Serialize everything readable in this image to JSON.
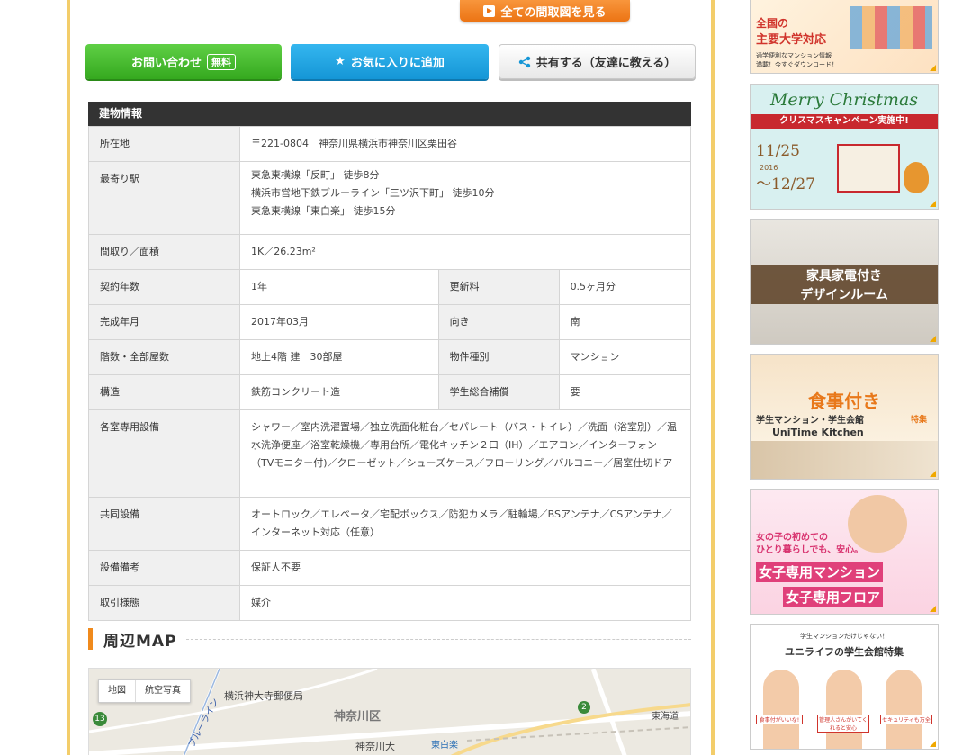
{
  "top_actions": {
    "floorplan_label": "全ての間取図を見る",
    "contact_label": "お問い合わせ",
    "contact_badge": "無料",
    "favorite_label": "お気に入りに追加",
    "share_label": "共有する（友達に教える）"
  },
  "building_info": {
    "title": "建物情報",
    "address_label": "所在地",
    "address_value": "〒221-0804　神奈川県横浜市神奈川区栗田谷",
    "station_label": "最寄り駅",
    "station_lines": [
      "東急東横線「反町」 徒歩8分",
      "横浜市営地下鉄ブルーライン「三ツ沢下町」 徒歩10分",
      "東急東横線「東白楽」 徒歩15分"
    ],
    "layout_label": "間取り／面積",
    "layout_value": "1K／26.23m²",
    "contract_label": "契約年数",
    "contract_value": "1年",
    "renewal_label": "更新料",
    "renewal_value": "0.5ヶ月分",
    "completed_label": "完成年月",
    "completed_value": "2017年03月",
    "direction_label": "向き",
    "direction_value": "南",
    "floors_label": "階数・全部屋数",
    "floors_value": "地上4階 建　30部屋",
    "type_label": "物件種別",
    "type_value": "マンション",
    "structure_label": "構造",
    "structure_value": "鉄筋コンクリート造",
    "insurance_label": "学生総合補償",
    "insurance_value": "要",
    "room_equip_label": "各室専用設備",
    "room_equip_value": "シャワー／室内洗濯置場／独立洗面化粧台／セパレート（バス・トイレ）／洗面（浴室別）／温水洗浄便座／浴室乾燥機／専用台所／電化キッチン２口（IH）／エアコン／インターフォン（TVモニター付)／クローゼット／シューズケース／フローリング／バルコニー／居室仕切ドア",
    "shared_equip_label": "共同設備",
    "shared_equip_value": "オートロック／エレベータ／宅配ボックス／防犯カメラ／駐輪場／BSアンテナ／CSアンテナ／インターネット対応（任意）",
    "equip_note_label": "設備備考",
    "equip_note_value": "保証人不要",
    "trade_label": "取引様態",
    "trade_value": "媒介"
  },
  "map_section": {
    "title": "周辺MAP",
    "tab_map": "地図",
    "tab_aerial": "航空写真",
    "labels": {
      "post_office": "横浜神大寺郵便局",
      "ward": "神奈川区",
      "university": "神奈川大",
      "station": "東白楽",
      "line": "ブルーライン",
      "road": "東海道",
      "route_num": "2",
      "route_13": "13"
    }
  },
  "sidebar": {
    "b1_line1": "全国の",
    "b1_line2": "主要大学対応",
    "b1_line3": "通学便利なマンション情報",
    "b1_line4": "満載！今すぐダウンロード！",
    "b2_title": "Merry Christmas",
    "b2_sub": "クリスマスキャンペーン実施中!",
    "b2_date1": "11/25",
    "b2_date2": "～12/27",
    "b2_year": "2016",
    "b3_line1": "家具家電付き",
    "b3_line2": "デザインルーム",
    "b4_line1": "食事付き",
    "b4_line2": "学生マンション・学生会館",
    "b4_tag": "特集",
    "b4_brand": "UniTime Kitchen",
    "b5_line1": "女の子の初めての",
    "b5_line2": "ひとり暮らしでも、安心。",
    "b5_line3": "女子専用マンション",
    "b5_line4": "女子専用フロア",
    "b6_line1": "学生マンションだけじゃない！",
    "b6_line2": "ユニライフの学生会館特集",
    "b6_bubble1": "食事付がいいな!",
    "b6_bubble2": "管理人さんがいてくれると安心",
    "b6_bubble3": "セキュリティも万全"
  },
  "colors": {
    "frame": "#f3cd6a",
    "contact": "#35a91f",
    "favorite": "#1596d6",
    "accent_orange": "#ec7414",
    "table_header": "#333333"
  }
}
